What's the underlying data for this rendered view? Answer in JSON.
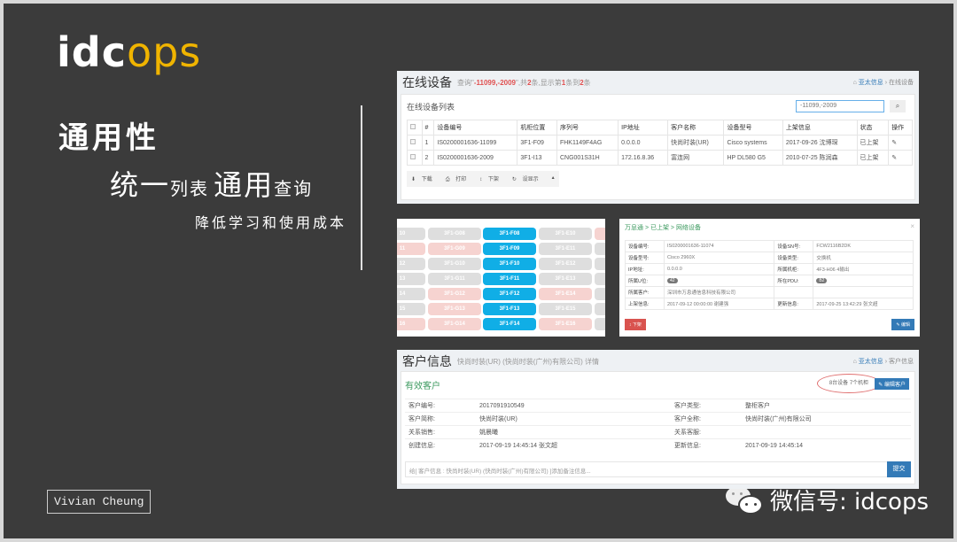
{
  "slide": {
    "logo": {
      "white": "idc",
      "yellow": "ops"
    },
    "heading": "通用性",
    "subheading": {
      "p1": "统一",
      "p2": "列表",
      "p3": "通用",
      "p4": "查询"
    },
    "tagline": "降低学习和使用成本",
    "author": "Vivian Cheung",
    "wechat": "微信号: idcops"
  },
  "online_devices": {
    "title": "在线设备",
    "subtitle_pre": "查询\"",
    "subtitle_query": "-11099,-2009",
    "subtitle_mid": "\",共",
    "subtitle_total": "2",
    "subtitle_mid2": "条,显示第",
    "subtitle_from": "1",
    "subtitle_mid3": "条到",
    "subtitle_to": "2",
    "subtitle_end": "条",
    "breadcrumb": [
      "亚太信息",
      "在线设备"
    ],
    "list_title": "在线设备列表",
    "search_value": "-11099,-2009",
    "columns": [
      "#",
      "设备编号",
      "机柜位置",
      "序列号",
      "IP地址",
      "客户名称",
      "设备型号",
      "上架信息",
      "状态",
      "操作"
    ],
    "rows": [
      {
        "n": "1",
        "id": "IS0200001636-11099",
        "rack": "3F1-F09",
        "sn": "FHK1149F4AG",
        "ip": "0.0.0.0",
        "customer": "快尚时装(UR)",
        "model": "Cisco systems",
        "onboard": "2017-09-26 沈博琛",
        "status": "已上架"
      },
      {
        "n": "2",
        "id": "IS0200001636-2009",
        "rack": "3F1-I13",
        "sn": "CNG001S31H",
        "ip": "172.16.8.36",
        "customer": "富连网",
        "model": "HP DL580 G5",
        "onboard": "2010-07-25 陈润森",
        "status": "已上架"
      }
    ],
    "toolbar": [
      "下载",
      "打印",
      "下架",
      "设显示",
      "▴"
    ]
  },
  "rack_map": {
    "col_a": [
      "10",
      "11",
      "12",
      "13",
      "14",
      "15",
      "16"
    ],
    "col_a_state": [
      "g",
      "p",
      "g",
      "g",
      "g",
      "g",
      "p"
    ],
    "col_b": [
      "3F1-G08",
      "3F1-G09",
      "3F1-G10",
      "3F1-G11",
      "3F1-G12",
      "3F1-G13",
      "3F1-G14"
    ],
    "col_b_state": [
      "g",
      "p",
      "g",
      "g",
      "p",
      "p",
      "p"
    ],
    "col_c": [
      "3F1-F08",
      "3F1-F09",
      "3F1-F10",
      "3F1-F11",
      "3F1-F12",
      "3F1-F13",
      "3F1-F14"
    ],
    "col_d": [
      "3F1-E10",
      "3F1-E11",
      "3F1-E12",
      "3F1-E13",
      "3F1-E14",
      "3F1-E15",
      "3F1-E16"
    ],
    "col_d_state": [
      "g",
      "g",
      "g",
      "g",
      "p",
      "g",
      "p"
    ]
  },
  "device_detail": {
    "breadcrumb": "万息通 > 已上架 > 网络设备",
    "close": "×",
    "rows": [
      {
        "k1": "设备编号:",
        "v1": "IS0200001636-11074",
        "k2": "设备SN号:",
        "v2": "FCW2116B2DK"
      },
      {
        "k1": "设备型号:",
        "v1": "Cisco 2960X",
        "k2": "设备类型:",
        "v2": "交换机"
      },
      {
        "k1": "IP地址:",
        "v1": "0.0.0.0",
        "k2": "所属机柜:",
        "v2": "4F3-H06 4输出"
      },
      {
        "k1": "所属U位:",
        "v1": "42",
        "k2": "所在PDU:",
        "v2": "B2"
      },
      {
        "k1": "所属客户:",
        "v1": "深圳市万息通信息科技有限公司",
        "k2": "",
        "v2": ""
      },
      {
        "k1": "上架信息:",
        "v1": "2017-09-12 00:00:00 谢建强",
        "k2": "更新信息:",
        "v2": "2017-09-25 13:42:29 张文超"
      }
    ],
    "btn_off": "下架",
    "btn_edit": "编辑"
  },
  "customer": {
    "title": "客户信息",
    "subtitle": "快尚时装(UR) (快尚时装(广州)有限公司) 详情",
    "breadcrumb": [
      "亚太信息",
      "客户信息"
    ],
    "status": "有效客户",
    "summary": "8台设备  7个机柜",
    "edit_btn": "编辑客户",
    "rows": [
      {
        "k1": "客户编号:",
        "v1": "2017091910549",
        "k2": "客户类型:",
        "v2": "整柜客户"
      },
      {
        "k1": "客户简称:",
        "v1": "快尚时装(UR)",
        "k2": "客户全称:",
        "v2": "快尚时装(广州)有限公司"
      },
      {
        "k1": "关系销售:",
        "v1": "姚晨曦",
        "k2": "关系客服:",
        "v2": ""
      },
      {
        "k1": "创建信息:",
        "v1": "2017-09-19 14:45:14 张文超",
        "k2": "更新信息:",
        "v2": "2017-09-19 14:45:14"
      }
    ],
    "remark_placeholder": "给[ 客户信息 : 快尚时装(UR) (快尚时装(广州)有限公司) ]添加备注信息...",
    "submit": "提交"
  }
}
